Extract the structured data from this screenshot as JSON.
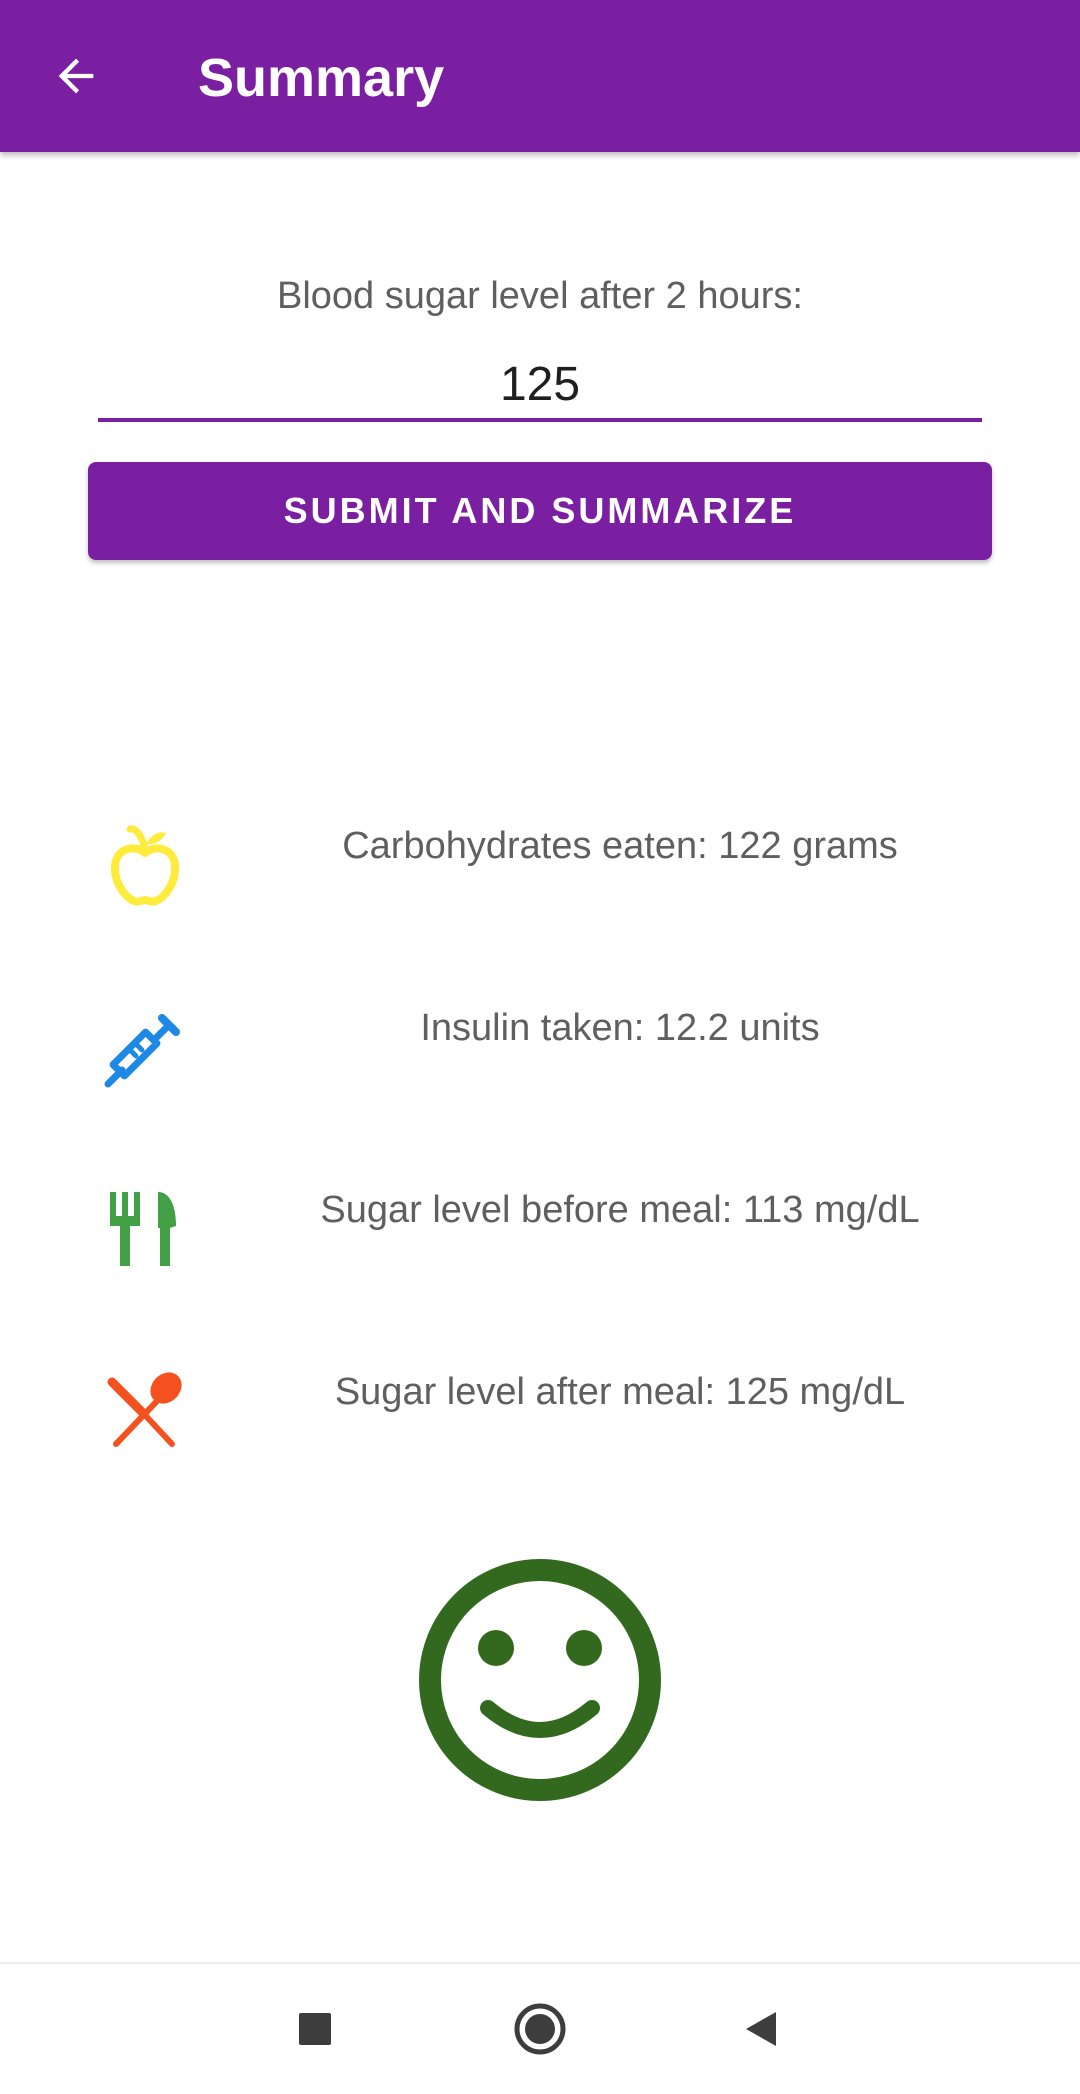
{
  "app_bar": {
    "title": "Summary",
    "back_icon": "arrow-back-icon",
    "background_color": "#7B1FA2"
  },
  "input_section": {
    "label": "Blood sugar level after 2 hours:",
    "value": "125",
    "underline_color": "#7B1FA2"
  },
  "submit_button": {
    "label": "SUBMIT AND SUMMARIZE",
    "color": "#7B1FA2"
  },
  "summary_items": [
    {
      "icon": "apple-icon",
      "icon_color": "#FFEB3B",
      "text": "Carbohydrates eaten: 122 grams"
    },
    {
      "icon": "syringe-icon",
      "icon_color": "#1E88E5",
      "text": "Insulin taken: 12.2 units"
    },
    {
      "icon": "fork-knife-icon",
      "icon_color": "#43A047",
      "text": "Sugar level before meal: 113 mg/dL"
    },
    {
      "icon": "spoon-knife-crossed-icon",
      "icon_color": "#F4511E",
      "text": "Sugar level after meal: 125 mg/dL"
    }
  ],
  "status_face": {
    "icon": "smiley-face-icon",
    "color": "#33691E"
  },
  "nav_bar": {
    "icons": [
      "square-recents-icon",
      "circle-home-icon",
      "triangle-back-icon"
    ]
  }
}
